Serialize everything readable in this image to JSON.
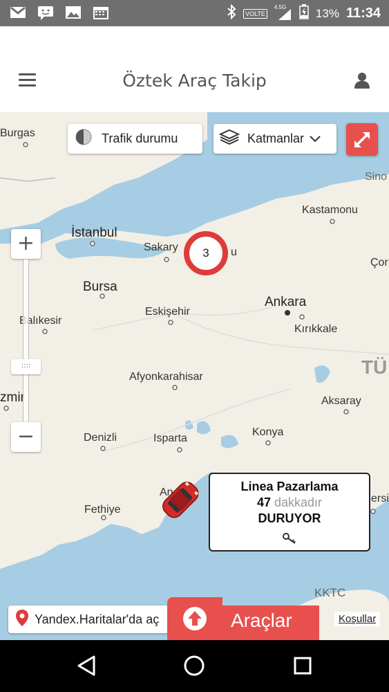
{
  "status_bar": {
    "network_label": "VOLTE",
    "network_type": "4.5G",
    "battery": "13%",
    "time": "11:34",
    "icons": [
      "gmail-icon",
      "message-icon",
      "gallery-icon",
      "calendar-icon",
      "bluetooth-icon",
      "signal-icon",
      "battery-icon"
    ]
  },
  "header": {
    "title": "Öztek Araç Takip",
    "menu_icon": "hamburger-menu-icon",
    "user_icon": "user-icon"
  },
  "map": {
    "controls": {
      "traffic_label": "Trafik durumu",
      "layers_label": "Katmanlar",
      "zoom_in": "+",
      "zoom_out": "−",
      "zoom_handle": "::::"
    },
    "cities": {
      "burgas": "Burgas",
      "sinop": "Sino",
      "kastamonu": "Kastamonu",
      "istanbul": "İstanbul",
      "sakarya": "Sakary",
      "bolu": "u",
      "corum": "Çor",
      "bursa": "Bursa",
      "ankara": "Ankara",
      "balikesir": "Balıkesir",
      "eskisehir": "Eskişehir",
      "kirikkale": "Kırıkkale",
      "turkiye": "TÜ",
      "afyon": "Afyonkarahisar",
      "izmir": "zmir",
      "aksaray": "Aksaray",
      "denizli": "Denizli",
      "isparta": "Isparta",
      "konya": "Konya",
      "antalya": "An",
      "mersin": "ersin",
      "fethiye": "Fethiye",
      "kktc": "KKTC",
      "kktc2": "C"
    },
    "cluster_count": "3",
    "popup": {
      "name": "Linea Pazarlama",
      "minutes": "47",
      "minutes_unit": "dakkadır",
      "status": "DURUYOR"
    },
    "yandex_label": "Yandex.Haritalar'da aç",
    "vehicles_label": "Araçlar",
    "terms_label": "Koşullar",
    "colors": {
      "accent": "#e8504d",
      "sea": "#a6cde3",
      "land": "#f2efe6"
    }
  }
}
